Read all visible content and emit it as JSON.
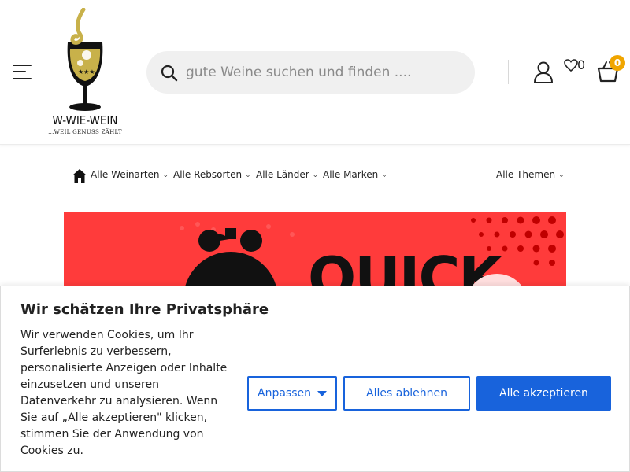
{
  "brand": {
    "name": "W-WIE-WEIN",
    "tagline": "...WEIL GENUSS ZÄHLT",
    "accent": "#c8b14a"
  },
  "search": {
    "placeholder": "gute Weine suchen und finden ...."
  },
  "header": {
    "wishlist_count": "0",
    "cart_count": "0",
    "badge_color": "#f0a500"
  },
  "nav": {
    "items": [
      {
        "label": "Alle Weinarten"
      },
      {
        "label": "Alle Rebsorten"
      },
      {
        "label": "Alle Länder"
      },
      {
        "label": "Alle Marken"
      },
      {
        "label": "Alle Themen"
      }
    ]
  },
  "banner": {
    "color": "#ff3b3b"
  },
  "cookie": {
    "title": "Wir schätzen Ihre Privatsphäre",
    "text": "Wir verwenden Cookies, um Ihr Surferlebnis zu verbessern, personalisierte Anzeigen oder Inhalte einzusetzen und unseren Datenverkehr zu analysieren. Wenn Sie auf „Alle akzeptieren\" klicken, stimmen Sie der Anwendung von Cookies zu.",
    "customize_label": "Anpassen",
    "reject_label": "Alles ablehnen",
    "accept_label": "Alle akzeptieren",
    "button_color": "#1863dc"
  }
}
